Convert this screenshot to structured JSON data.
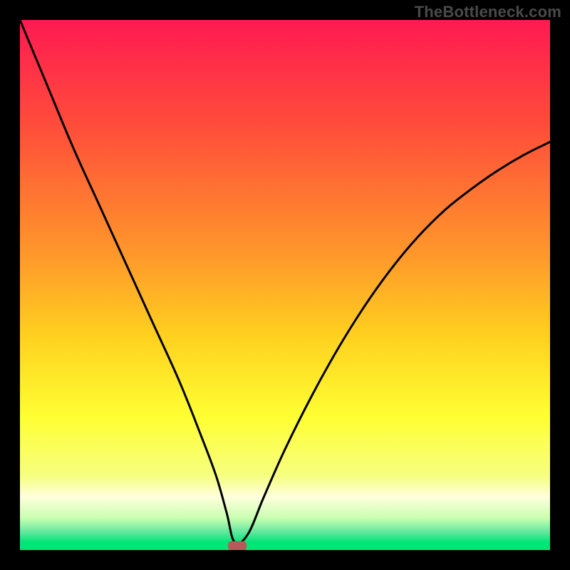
{
  "watermark": "TheBottleneck.com",
  "chart_data": {
    "type": "line",
    "title": "",
    "xlabel": "",
    "ylabel": "",
    "xlim": [
      0,
      100
    ],
    "ylim": [
      0,
      100
    ],
    "series": [
      {
        "name": "bottleneck-curve",
        "x": [
          0,
          5,
          10,
          15,
          20,
          25,
          30,
          34,
          37,
          39,
          40.5,
          43,
          46,
          50,
          55,
          60,
          65,
          70,
          75,
          80,
          85,
          90,
          95,
          100
        ],
        "y": [
          100,
          88,
          76,
          65,
          54,
          43,
          32,
          22,
          14,
          7,
          1.5,
          3,
          10,
          19,
          29,
          38,
          46,
          53,
          59,
          64,
          68,
          71.5,
          74.5,
          77
        ]
      }
    ],
    "marker": {
      "x": 41,
      "y": 0.8
    },
    "gradient_stops": [
      {
        "offset": 0.0,
        "color": "#ff1a52"
      },
      {
        "offset": 0.2,
        "color": "#ff4d3a"
      },
      {
        "offset": 0.45,
        "color": "#ff9a2a"
      },
      {
        "offset": 0.6,
        "color": "#ffd21f"
      },
      {
        "offset": 0.75,
        "color": "#ffff33"
      },
      {
        "offset": 0.86,
        "color": "#f6ff80"
      },
      {
        "offset": 0.9,
        "color": "#ffffdd"
      },
      {
        "offset": 0.94,
        "color": "#c8ffb0"
      },
      {
        "offset": 0.965,
        "color": "#66e8a0"
      },
      {
        "offset": 0.985,
        "color": "#00e676"
      },
      {
        "offset": 1.0,
        "color": "#00e676"
      }
    ]
  }
}
